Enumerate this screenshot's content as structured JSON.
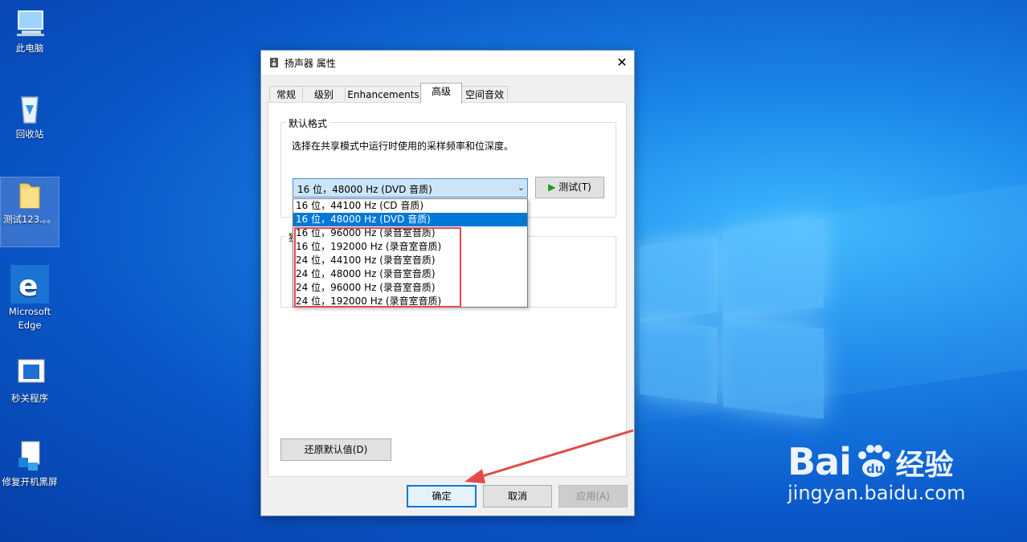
{
  "desktop": {
    "icons": [
      {
        "label": "此电脑",
        "icon": "computer-icon"
      },
      {
        "label": "回收站",
        "icon": "recycle-bin-icon"
      },
      {
        "label": "测试123.。。",
        "icon": "folder-icon"
      },
      {
        "label": "Microsoft Edge",
        "icon": "edge-icon"
      },
      {
        "label": "秒关程序",
        "icon": "program-icon"
      },
      {
        "label": "修复开机黑屏",
        "icon": "repair-icon"
      }
    ]
  },
  "dialog": {
    "title": "扬声器 属性",
    "close": "✕",
    "tabs": [
      {
        "label": "常规"
      },
      {
        "label": "级别"
      },
      {
        "label": "Enhancements"
      },
      {
        "label": "高级"
      },
      {
        "label": "空间音效"
      }
    ],
    "active_tab": "高级",
    "default_format": {
      "group_label": "默认格式",
      "description": "选择在共享模式中运行时使用的采样频率和位深度。",
      "selected": "16 位，48000 Hz (DVD 音质)",
      "test_button": "测试(T)",
      "options": [
        "16 位，44100 Hz (CD 音质)",
        "16 位，48000 Hz (DVD 音质)",
        "16 位，96000 Hz (录音室音质)",
        "16 位，192000 Hz (录音室音质)",
        "24 位，44100 Hz (录音室音质)",
        "24 位，48000 Hz (录音室音质)",
        "24 位，96000 Hz (录音室音质)",
        "24 位，192000 Hz (录音室音质)"
      ]
    },
    "exclusive_group_label": "独",
    "restore_button": "还原默认值(D)",
    "ok_button": "确定",
    "cancel_button": "取消",
    "apply_button": "应用(A)"
  },
  "watermark": {
    "brand": "Bai",
    "brand2": "经验",
    "url": "jingyan.baidu.com"
  },
  "colors": {
    "accent": "#0078d7",
    "highlight_box": "#e24a4a",
    "desktop_blue": "#0a56c8"
  }
}
